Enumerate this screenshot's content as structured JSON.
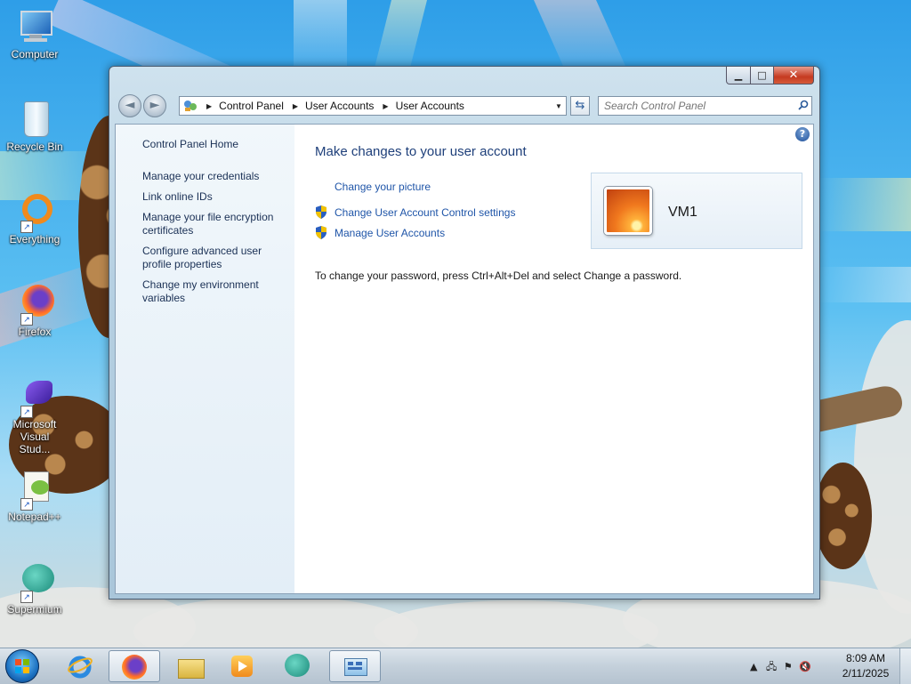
{
  "desktop": {
    "icons": [
      {
        "label": "Computer",
        "icon": "computer-icon"
      },
      {
        "label": "Recycle Bin",
        "icon": "recycle-bin-icon"
      },
      {
        "label": "Everything",
        "icon": "everything-icon"
      },
      {
        "label": "Firefox",
        "icon": "firefox-icon"
      },
      {
        "label": "Microsoft Visual Stud...",
        "icon": "visual-studio-icon"
      },
      {
        "label": "Notepad++",
        "icon": "notepad-plus-plus-icon"
      },
      {
        "label": "Supermium",
        "icon": "supermium-icon"
      }
    ]
  },
  "window": {
    "buttons": {
      "minimize": "▁",
      "maximize": "□",
      "close": "✕"
    },
    "nav": {
      "back": "◄",
      "forward": "►"
    },
    "breadcrumb": [
      "Control Panel",
      "User Accounts",
      "User Accounts"
    ],
    "search_placeholder": "Search Control Panel",
    "left_pane": {
      "home": "Control Panel Home",
      "items": [
        "Manage your credentials",
        "Link online IDs",
        "Manage your file encryption certificates",
        "Configure advanced user profile properties",
        "Change my environment variables"
      ]
    },
    "main": {
      "title": "Make changes to your user account",
      "tasks": [
        {
          "label": "Change your picture",
          "shield": false
        },
        {
          "label": "Change User Account Control settings",
          "shield": true
        },
        {
          "label": "Manage User Accounts",
          "shield": true
        }
      ],
      "user_name": "VM1",
      "password_note": "To change your password, press Ctrl+Alt+Del and select Change a password."
    },
    "help": "?"
  },
  "taskbar": {
    "apps": [
      {
        "name": "internet-explorer",
        "active": false
      },
      {
        "name": "firefox",
        "active": true
      },
      {
        "name": "file-explorer",
        "active": false
      },
      {
        "name": "media-player",
        "active": false
      },
      {
        "name": "supermium",
        "active": false
      },
      {
        "name": "control-panel",
        "active": true
      }
    ],
    "time": "8:09 AM",
    "date": "2/11/2025"
  }
}
